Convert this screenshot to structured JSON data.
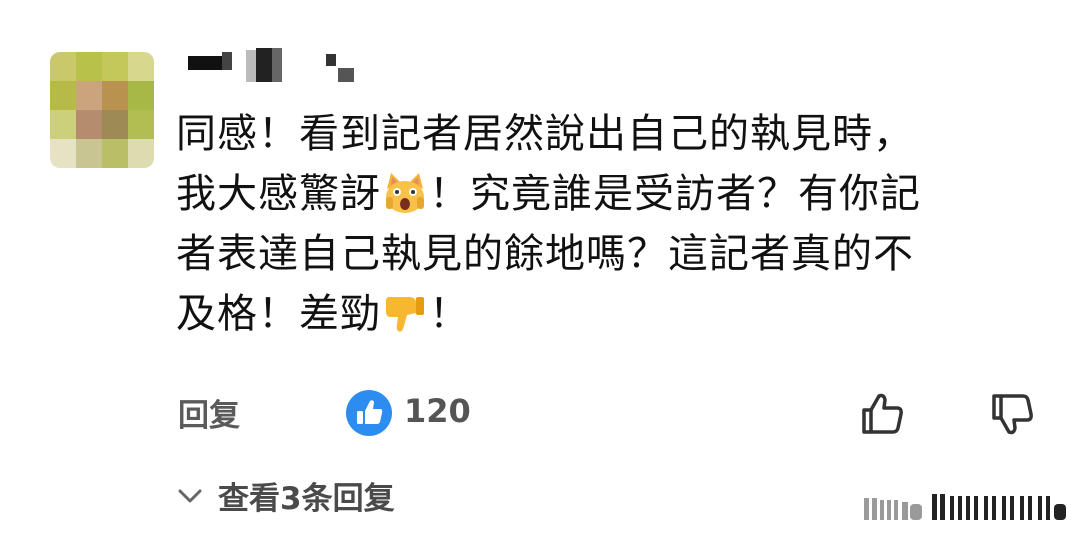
{
  "comment": {
    "line1": "同感！看到記者居然說出自己的執見時，",
    "line2a": "我大感驚訝",
    "line2b": "！究竟誰是受訪者？有你記",
    "line3": "者表達自己執見的餘地嗎？這記者真的不",
    "line4a": "及格！差勁",
    "line4b": "！",
    "emoji1": "scream-cat-emoji",
    "emoji2": "thumbs-down-emoji"
  },
  "actions": {
    "reply_label": "回复",
    "like_count": "120",
    "like_icon": "thumbs-up-icon",
    "right_icons": [
      "thumbs-up-outline-icon",
      "thumbs-down-outline-icon"
    ],
    "accent_color": "#2d8cf0"
  },
  "replies": {
    "view_label": "查看3条回复",
    "chevron_icon": "chevron-down-icon"
  }
}
